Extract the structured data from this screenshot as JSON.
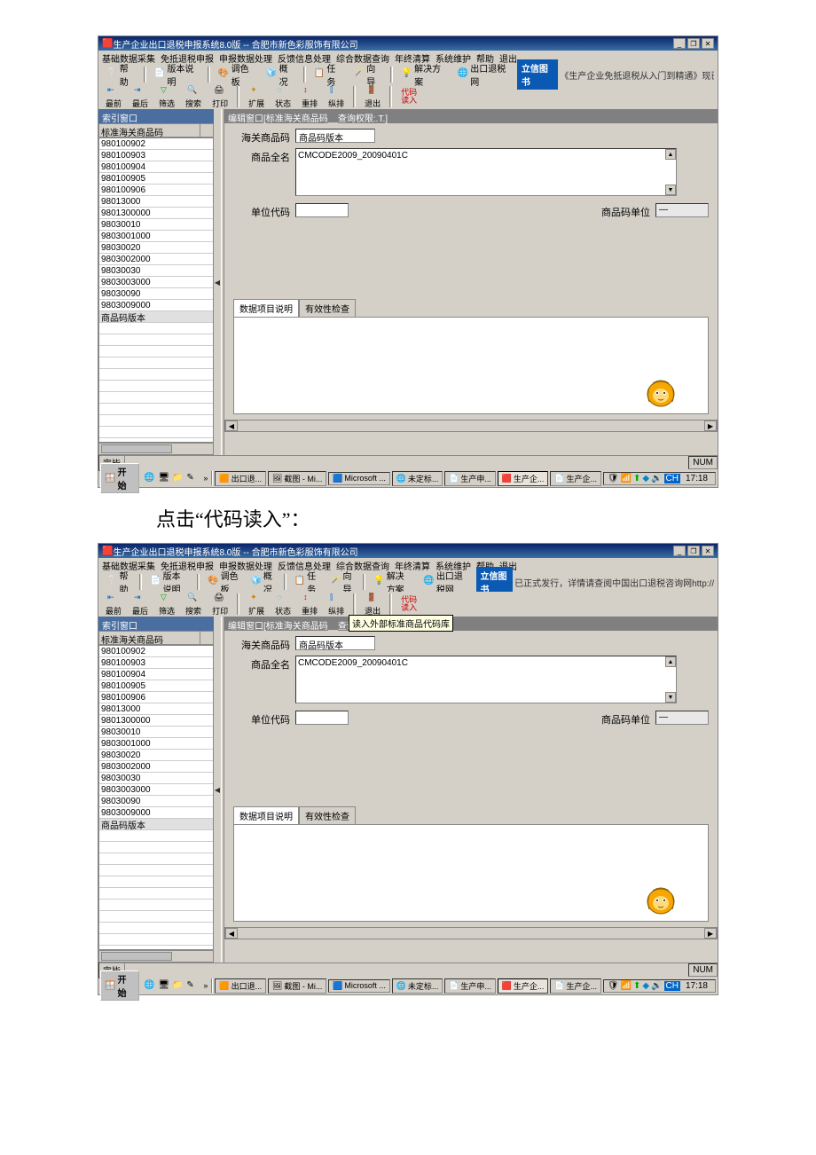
{
  "page_caption": "点击“代码读入”：",
  "title": "生产企业出口退税申报系统8.0版 -- 合肥市新色彩服饰有限公司",
  "menu_items": [
    "基础数据采集",
    "免抵退税申报",
    "申报数据处理",
    "反馈信息处理",
    "综合数据查询",
    "年终清算",
    "系统维护",
    "帮助",
    "退出"
  ],
  "toolbar1": [
    {
      "id": "help",
      "label": "帮助"
    },
    {
      "id": "ver",
      "label": "版本说明"
    },
    {
      "sep": true
    },
    {
      "id": "palette",
      "label": "调色板"
    },
    {
      "id": "overview",
      "label": "概况"
    },
    {
      "sep": true
    },
    {
      "id": "tasks",
      "label": "任务"
    },
    {
      "id": "wizard",
      "label": "向导"
    },
    {
      "sep": true
    },
    {
      "id": "scheme",
      "label": "解决方案"
    },
    {
      "id": "exptax",
      "label": "出口退税网"
    },
    {
      "id": "buybook",
      "label": "立信图书"
    }
  ],
  "ticker_a": "《生产企业免抵退税从入门到精通》现已正",
  "ticker_b": "已正式发行，详情请查阅中国出口退税咨询网http://www.taxrefun",
  "toolbar2": [
    {
      "id": "first",
      "label": "最前"
    },
    {
      "id": "last",
      "label": "最后"
    },
    {
      "id": "filter",
      "label": "筛选"
    },
    {
      "id": "search",
      "label": "搜索"
    },
    {
      "id": "print",
      "label": "打印"
    },
    {
      "sep": true
    },
    {
      "id": "expand",
      "label": "扩展"
    },
    {
      "id": "state",
      "label": "状态"
    },
    {
      "id": "sort",
      "label": "重排"
    },
    {
      "id": "vert",
      "label": "纵排"
    },
    {
      "sep": true
    },
    {
      "id": "exit",
      "label": "退出"
    },
    {
      "sep": true
    },
    {
      "id": "codeload",
      "label": "代码\n读入",
      "red": true
    }
  ],
  "codeload_tooltip": "读入外部标准商品代码库",
  "left_panel": {
    "title": "索引窗口",
    "column_header": "标准海关商品码",
    "rows": [
      "980100902",
      "980100903",
      "980100904",
      "980100905",
      "980100906",
      "98013000",
      "9801300000",
      "98030010",
      "9803001000",
      "98030020",
      "9803002000",
      "98030030",
      "9803003000",
      "98030090",
      "9803009000",
      "商品码版本"
    ],
    "selected": "商品码版本"
  },
  "edit_panel": {
    "title": "编辑窗口[标准海关商品码__查询权限:.T.]",
    "code_label": "海关商品码",
    "code_value": "商品码版本",
    "fullname_label": "商品全名",
    "fullname_value": "CMCODE2009_20090401C",
    "unit_code_label": "单位代码",
    "unit_code_value": "",
    "code_unit_label": "商品码单位",
    "code_unit_value": "—",
    "tabs": [
      "数据项目说明",
      "有效性检查"
    ],
    "active_tab": 0
  },
  "status_left": "完毕",
  "status_right": "NUM",
  "taskbar": {
    "start": "开始",
    "quicklaunch": [
      "ie-icon",
      "desktop-icon",
      "folder-icon",
      "edit-icon"
    ],
    "tasks": [
      {
        "label": "出口退..."
      },
      {
        "label": "截图 - Mi..."
      },
      {
        "label": "Microsoft ..."
      },
      {
        "label": "未定标..."
      },
      {
        "label": "生产申..."
      },
      {
        "label": "生产企...",
        "active": true
      },
      {
        "label": "生产企..."
      }
    ],
    "tray_icons": [
      "shield-icon",
      "net-icon",
      "up-icon",
      "safe-icon",
      "vol-icon",
      "ime-icon"
    ],
    "ime": "CH",
    "clock": "17:18"
  }
}
